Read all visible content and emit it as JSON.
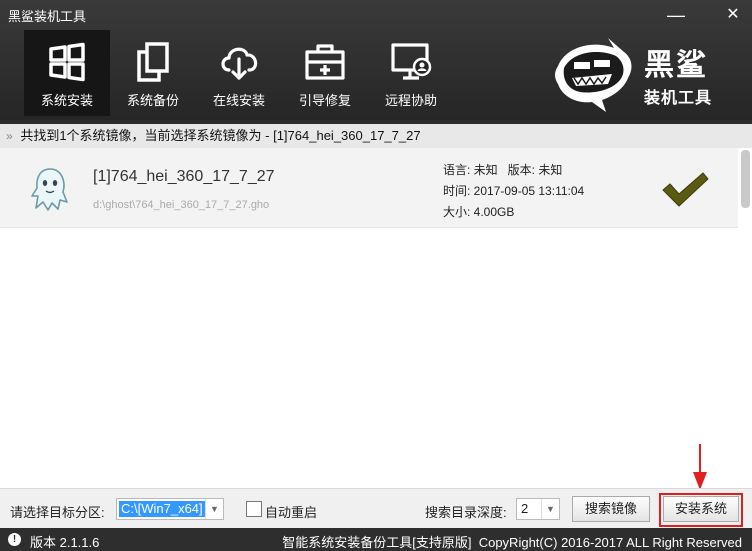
{
  "app": {
    "title": "黑鲨装机工具",
    "logo_text_1": "黑鲨",
    "logo_text_2": "装机工具"
  },
  "window_controls": {
    "minimize": "—",
    "close": "✕"
  },
  "nav": [
    {
      "label": "系统安装",
      "icon": "windows-icon",
      "active": true
    },
    {
      "label": "系统备份",
      "icon": "copy-icon"
    },
    {
      "label": "在线安装",
      "icon": "cloud-download-icon"
    },
    {
      "label": "引导修复",
      "icon": "toolbox-icon"
    },
    {
      "label": "远程协助",
      "icon": "monitor-user-icon"
    }
  ],
  "breadcrumb": {
    "text": "共找到1个系统镜像，当前选择系统镜像为 - [1]764_hei_360_17_7_27"
  },
  "image_list": [
    {
      "name": "[1]764_hei_360_17_7_27",
      "path": "d:\\ghost\\764_hei_360_17_7_27.gho",
      "language": "语言: 未知   版本: 未知",
      "time": "时间: 2017-09-05 13:11:04",
      "size": "大小: 4.00GB",
      "selected": true
    }
  ],
  "controls": {
    "partition_label": "请选择目标分区:",
    "partition_value": "C:\\[Win7_x64]",
    "auto_restart_label": "自动重启",
    "auto_restart_checked": false,
    "depth_label": "搜索目录深度:",
    "depth_value": "2",
    "search_button": "搜索镜像",
    "install_button": "安装系统"
  },
  "status": {
    "version": "版本 2.1.1.6",
    "copyright": "智能系统安装备份工具[支持原版]  CopyRight(C) 2016-2017 ALL Right Reserved"
  },
  "colors": {
    "header_bg": "#2b2b2b",
    "accent_red": "#e02020",
    "check_olive": "#5a5a12",
    "selection_blue": "#3399ff"
  }
}
